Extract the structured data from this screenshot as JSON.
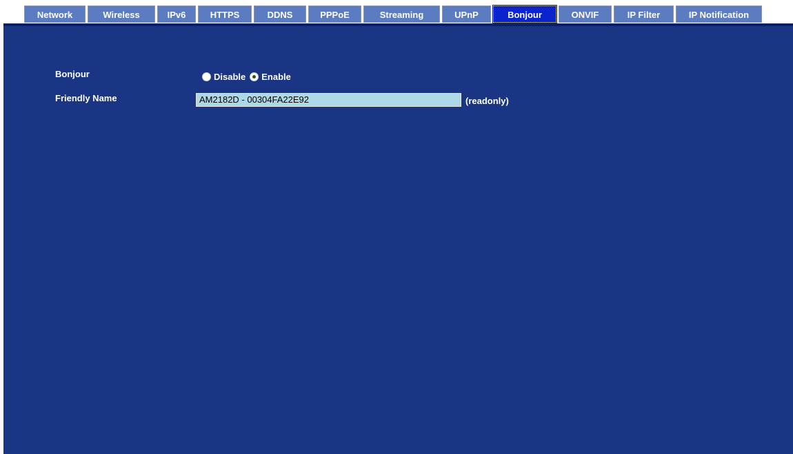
{
  "tabs": [
    {
      "label": "Network",
      "width": 89
    },
    {
      "label": "Wireless",
      "width": 98
    },
    {
      "label": "IPv6",
      "width": 56
    },
    {
      "label": "HTTPS",
      "width": 78
    },
    {
      "label": "DDNS",
      "width": 76
    },
    {
      "label": "PPPoE",
      "width": 77
    },
    {
      "label": "Streaming",
      "width": 111
    },
    {
      "label": "UPnP",
      "width": 71
    },
    {
      "label": "Bonjour",
      "width": 92
    },
    {
      "label": "ONVIF",
      "width": 77
    },
    {
      "label": "IP Filter",
      "width": 87
    },
    {
      "label": "IP Notification",
      "width": 125
    }
  ],
  "active_tab": "Bonjour",
  "form": {
    "bonjour_label": "Bonjour",
    "disable_label": "Disable",
    "enable_label": "Enable",
    "bonjour_value": "Enable",
    "friendly_name_label": "Friendly Name",
    "friendly_name_value": "AM2182D - 00304FA22E92",
    "readonly_note": "(readonly)"
  },
  "colors": {
    "panel_background": "#1b3585",
    "tab_background": "#5b7cc0",
    "tab_active_background": "#0a23cc",
    "field_background": "#add8e6"
  }
}
